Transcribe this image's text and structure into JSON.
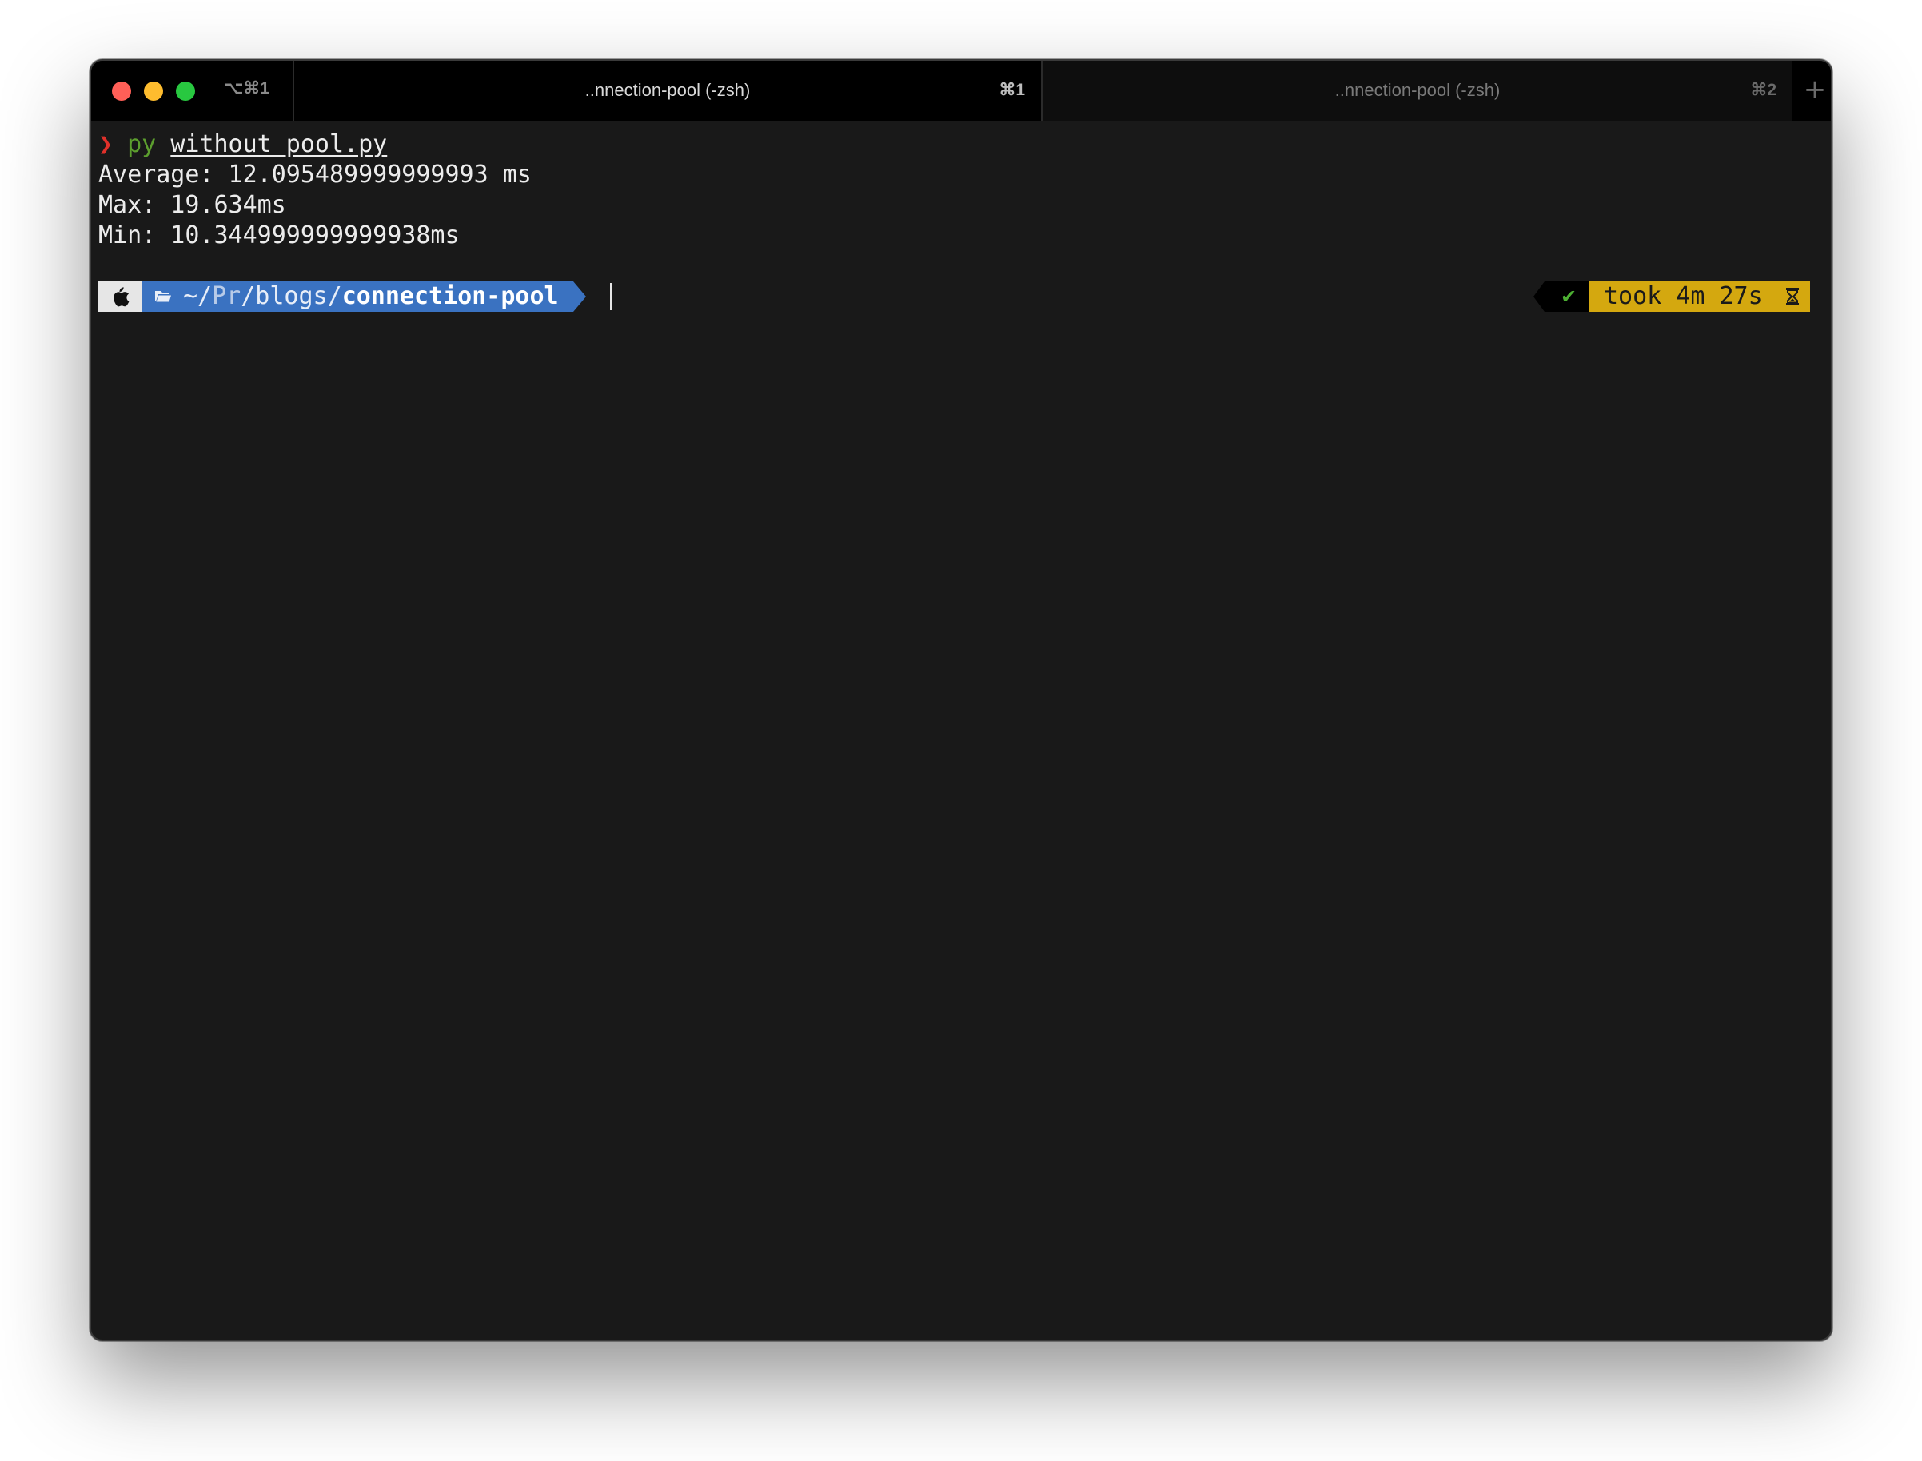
{
  "window": {
    "shortcut": "⌥⌘1",
    "tabs": [
      {
        "title": "..nnection-pool (-zsh)",
        "shortcut": "⌘1",
        "active": true
      },
      {
        "title": "..nnection-pool (-zsh)",
        "shortcut": "⌘2",
        "active": false
      }
    ],
    "new_tab": "+"
  },
  "terminal": {
    "command": {
      "chevron": "❯",
      "program": "py",
      "argument": "without_pool.py"
    },
    "output": [
      "Average: 12.095489999999993 ms",
      "Max: 19.634ms",
      "Min: 10.344999999999938ms"
    ],
    "prompt": {
      "path_home": "~/",
      "path_abbrev": "Pr",
      "path_mid": "/blogs/",
      "path_current": "connection-pool",
      "status_icon": "✔",
      "duration": "took 4m 27s"
    }
  },
  "colors": {
    "background": "#191919",
    "path_segment": "#3a72c1",
    "duration_segment": "#d4a80f",
    "chevron": "#e0302a",
    "program": "#5c9e2e",
    "success": "#4caf32"
  }
}
